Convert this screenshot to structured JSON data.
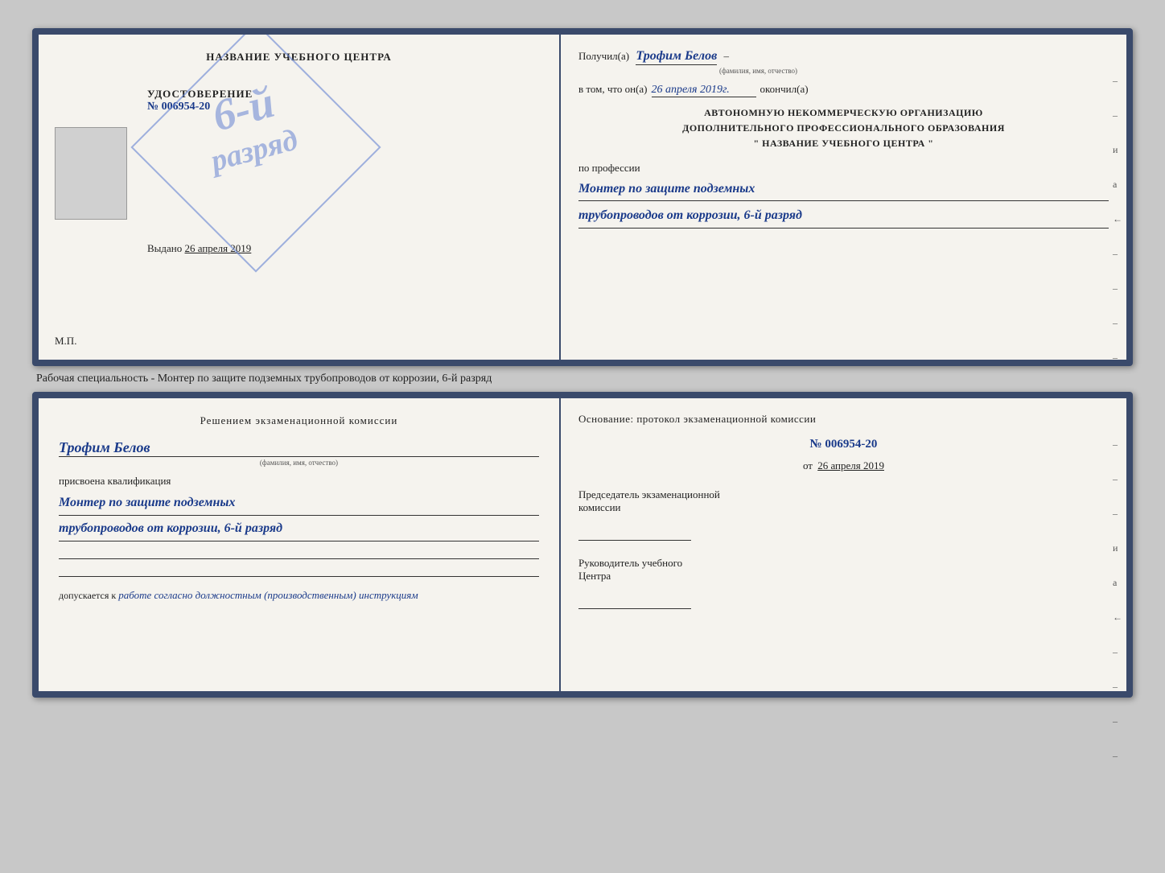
{
  "page": {
    "background_color": "#c8c8c8"
  },
  "cert1": {
    "left": {
      "title": "НАЗВАНИЕ УЧЕБНОГО ЦЕНТРА",
      "udost_label": "УДОСТОВЕРЕНИЕ",
      "udost_number": "№ 006954-20",
      "vydano_label": "Выдано",
      "vydano_date": "26 апреля 2019",
      "mp_label": "М.П."
    },
    "stamp": {
      "line1": "6-й",
      "line2": "разряд"
    },
    "right": {
      "poluchil_label": "Получил(а)",
      "poluchil_name": "Трофим Белов",
      "fio_hint": "(фамилия, имя, отчество)",
      "dash": "–",
      "vtom_label": "в том, что он(а)",
      "vtom_date": "26 апреля 2019г.",
      "okonchil_label": "окончил(а)",
      "org_line1": "АВТОНОМНУЮ НЕКОММЕРЧЕСКУЮ ОРГАНИЗАЦИЮ",
      "org_line2": "ДОПОЛНИТЕЛЬНОГО ПРОФЕССИОНАЛЬНОГО ОБРАЗОВАНИЯ",
      "org_name": "\" НАЗВАНИЕ УЧЕБНОГО ЦЕНТРА \"",
      "po_professii": "по профессии",
      "profession_line1": "Монтер по защите подземных",
      "profession_line2": "трубопроводов от коррозии, 6-й разряд",
      "side_dashes": [
        "-",
        "-",
        "и",
        "а",
        "←",
        "-",
        "-",
        "-",
        "-"
      ]
    }
  },
  "description": {
    "text": "Рабочая специальность - Монтер по защите подземных трубопроводов от коррозии, 6-й разряд"
  },
  "cert2": {
    "left": {
      "resheniem_label": "Решением экзаменационной комиссии",
      "fio_name": "Трофим Белов",
      "fio_hint": "(фамилия, имя, отчество)",
      "prisvoena_label": "присвоена квалификация",
      "kvalif_line1": "Монтер по защите подземных",
      "kvalif_line2": "трубопроводов от коррозии, 6-й разряд",
      "dopuskaetsya_prefix": "допускается к",
      "dopuskaetsya_text": "работе согласно должностным (производственным) инструкциям"
    },
    "right": {
      "osnovanie_label": "Основание: протокол экзаменационной комиссии",
      "protocol_number": "№ 006954-20",
      "ot_prefix": "от",
      "protocol_date": "26 апреля 2019",
      "predsedatel_line1": "Председатель экзаменационной",
      "predsedatel_line2": "комиссии",
      "rukovoditel_line1": "Руководитель учебного",
      "rukovoditel_line2": "Центра",
      "side_dashes": [
        "-",
        "-",
        "-",
        "и",
        "а",
        "←",
        "-",
        "-",
        "-",
        "-"
      ]
    }
  }
}
